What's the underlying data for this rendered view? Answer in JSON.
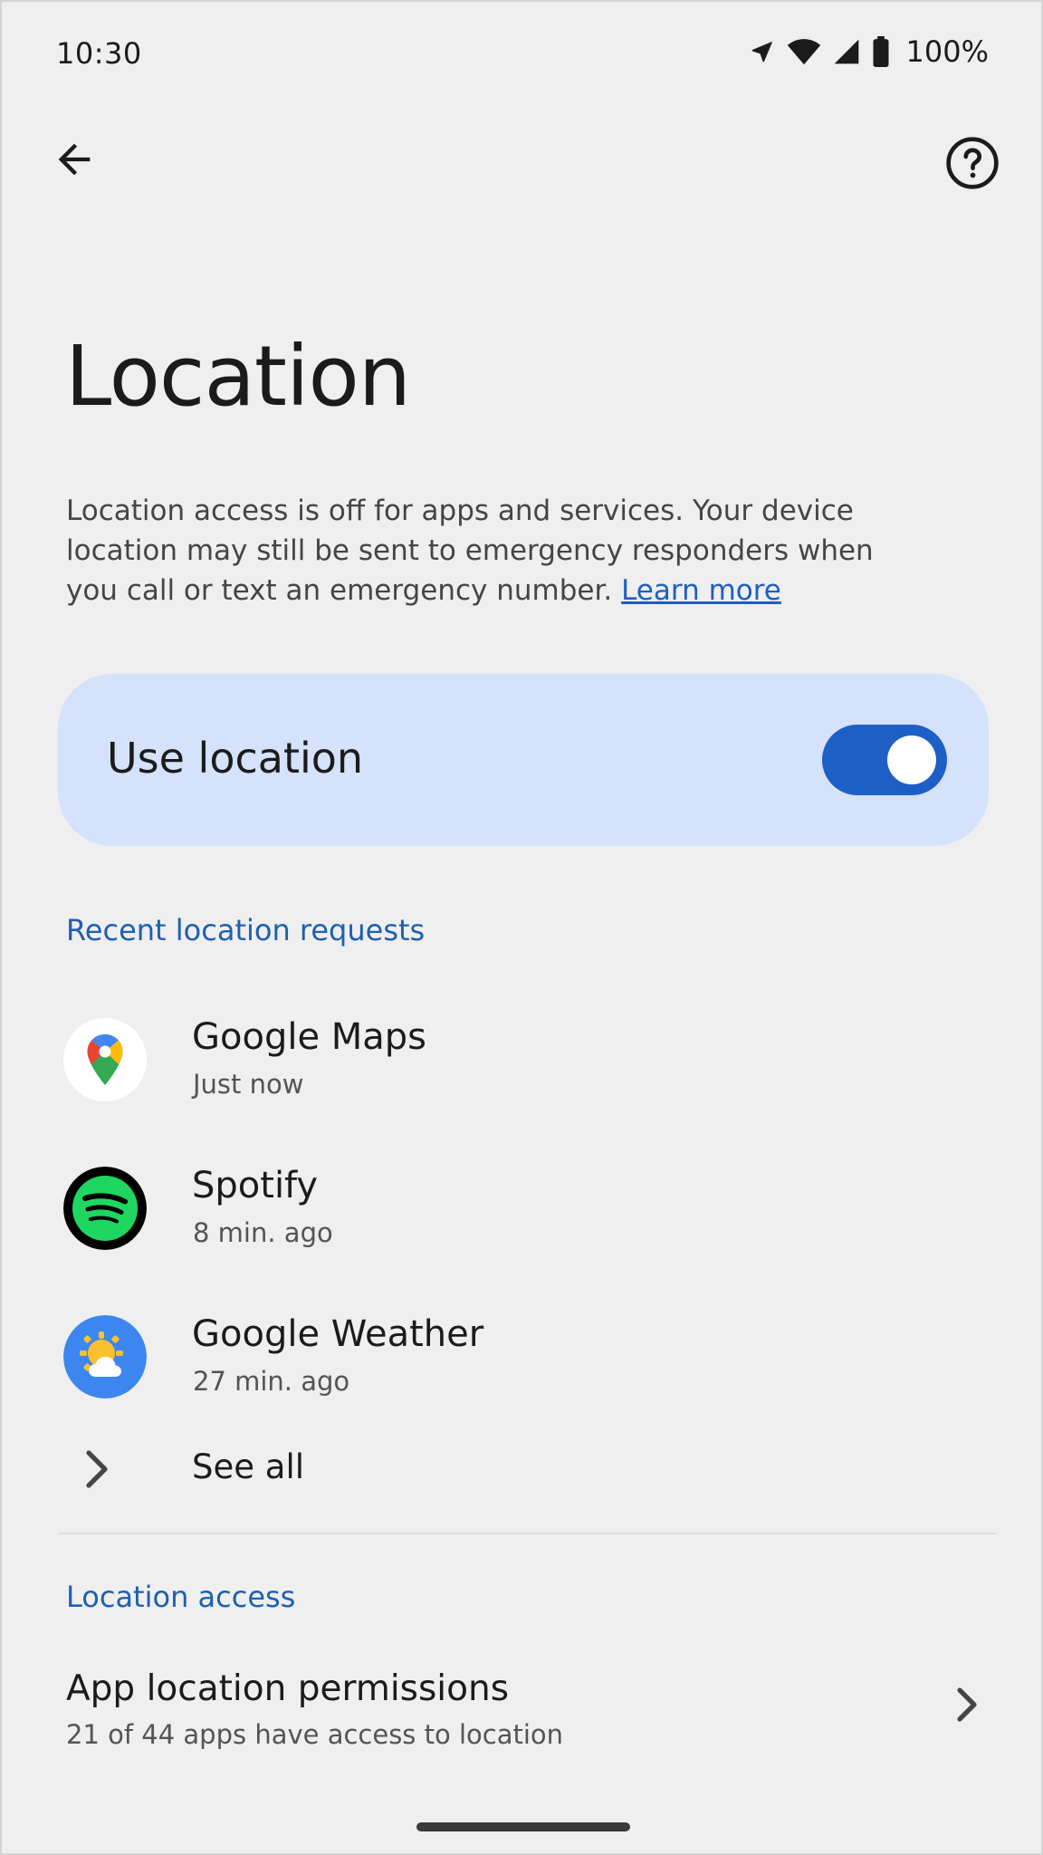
{
  "status_bar": {
    "time": "10:30",
    "battery": "100%",
    "icons": [
      "location-arrow-icon",
      "wifi-icon",
      "signal-icon",
      "battery-icon"
    ]
  },
  "app_bar": {
    "back_icon": "arrow-back-icon",
    "help_icon": "help-circle-icon"
  },
  "page": {
    "title": "Location",
    "description": "Location access is off for apps and services. Your device location may still be sent to emergency responders when you call or text an emergency number. ",
    "learn_more": "Learn more"
  },
  "use_location": {
    "label": "Use location",
    "enabled": true,
    "accent_color": "#1e5fc6",
    "card_color": "#d4e2fb"
  },
  "recent_requests": {
    "header": "Recent location requests",
    "apps": [
      {
        "name": "Google Maps",
        "time": "Just now",
        "icon": "google-maps-icon"
      },
      {
        "name": "Spotify",
        "time": "8 min. ago",
        "icon": "spotify-icon"
      },
      {
        "name": "Google Weather",
        "time": "27 min. ago",
        "icon": "google-weather-icon"
      }
    ],
    "see_all": "See all"
  },
  "location_access": {
    "header": "Location access",
    "permissions_title": "App location permissions",
    "permissions_subtitle": "21 of 44 apps have access to location"
  },
  "colors": {
    "background": "#efefef",
    "section_header": "#1f5fb0",
    "link": "#1d5fc2"
  }
}
